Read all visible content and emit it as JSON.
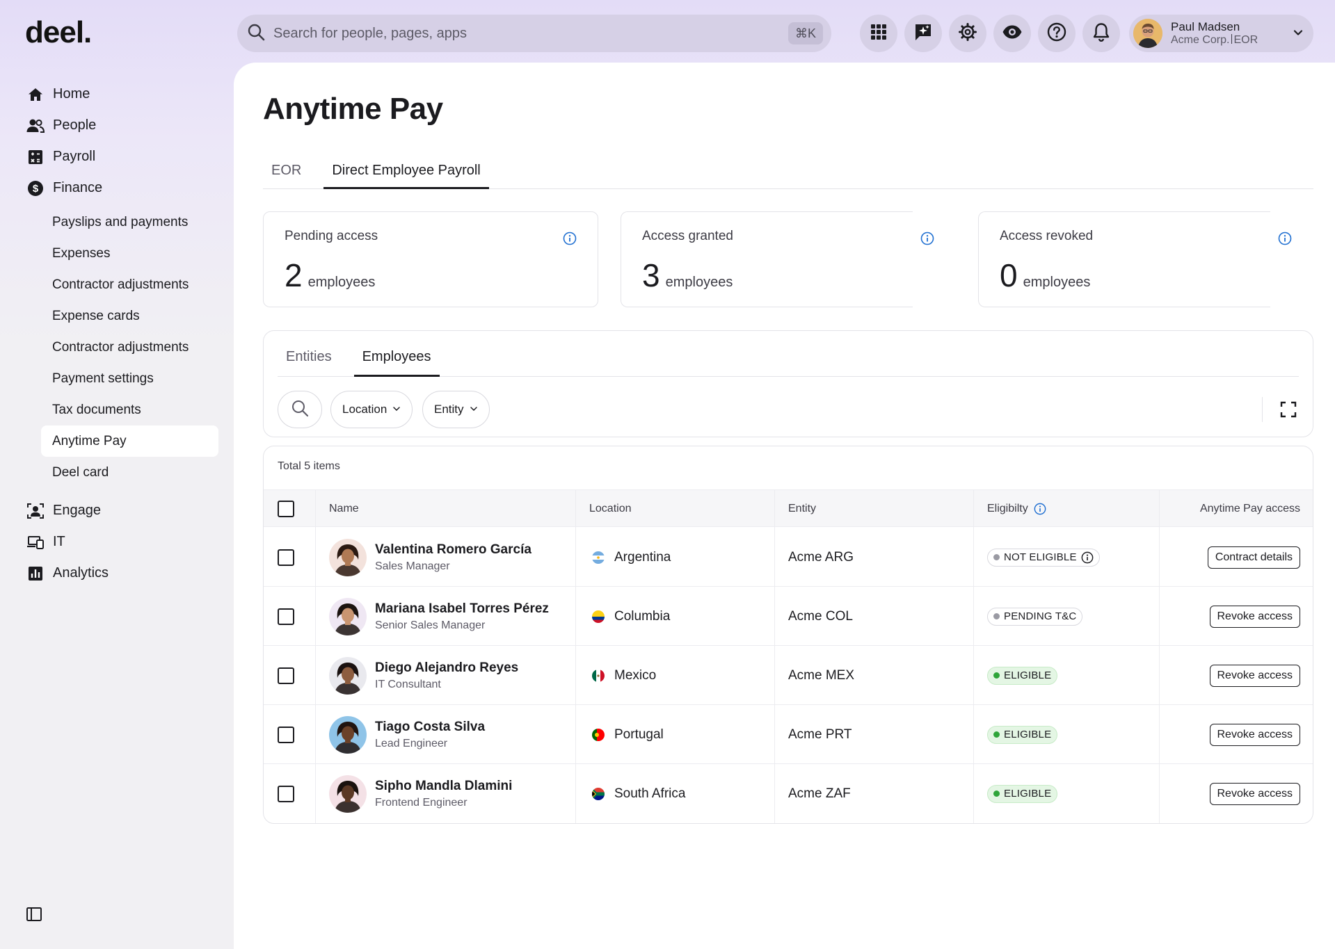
{
  "app": {
    "logo": "deel."
  },
  "sidebar": {
    "items": [
      {
        "label": "Home",
        "icon": "home-icon"
      },
      {
        "label": "People",
        "icon": "people-icon"
      },
      {
        "label": "Payroll",
        "icon": "payroll-icon"
      },
      {
        "label": "Finance",
        "icon": "dollar-icon"
      }
    ],
    "finance_sub": [
      "Payslips and payments",
      "Expenses",
      "Contractor adjustments",
      "Expense cards",
      "Contractor adjustments",
      "Payment settings",
      "Tax documents",
      "Anytime Pay",
      "Deel card"
    ],
    "bottom_items": [
      {
        "label": "Engage",
        "icon": "engage-icon"
      },
      {
        "label": "IT",
        "icon": "devices-icon"
      },
      {
        "label": "Analytics",
        "icon": "analytics-icon"
      }
    ]
  },
  "topbar": {
    "search_placeholder": "Search for people, pages, apps",
    "shortcut": "⌘K",
    "user_name": "Paul Madsen",
    "user_org": "Acme Corp.",
    "user_type": "EOR"
  },
  "page": {
    "title": "Anytime Pay",
    "tabs": [
      "EOR",
      "Direct Employee Payroll"
    ]
  },
  "stats": [
    {
      "label": "Pending access",
      "value": "2",
      "unit": "employees"
    },
    {
      "label": "Access granted",
      "value": "3",
      "unit": "employees"
    },
    {
      "label": "Access revoked",
      "value": "0",
      "unit": "employees"
    }
  ],
  "filters": {
    "sub_tabs": [
      "Entities",
      "Employees"
    ],
    "location_label": "Location",
    "entity_label": "Entity"
  },
  "table": {
    "total": "Total 5 items",
    "headers": {
      "name": "Name",
      "location": "Location",
      "entity": "Entity",
      "eligibility": "Eligibilty",
      "access": "Anytime Pay access"
    },
    "rows": [
      {
        "name": "Valentina Romero García",
        "role": "Sales Manager",
        "location": "Argentina",
        "entity": "Acme ARG",
        "status": "NOT ELIGIBLE",
        "status_type": "grey",
        "action": "Contract details",
        "skin": "#b07a55",
        "hair": "#2b1a12",
        "bg": "#f3e2dc"
      },
      {
        "name": "Mariana Isabel Torres Pérez",
        "role": "Senior Sales Manager",
        "location": "Columbia",
        "entity": "Acme COL",
        "status": "PENDING T&C",
        "status_type": "grey",
        "action": "Revoke access",
        "skin": "#c99571",
        "hair": "#1c1410",
        "bg": "#efe7f3"
      },
      {
        "name": "Diego Alejandro Reyes",
        "role": "IT Consultant",
        "location": "Mexico",
        "entity": "Acme MEX",
        "status": "ELIGIBLE",
        "status_type": "green",
        "action": "Revoke access",
        "skin": "#8d5d3f",
        "hair": "#1a1210",
        "bg": "#e9e9ee"
      },
      {
        "name": "Tiago Costa Silva",
        "role": "Lead Engineer",
        "location": "Portugal",
        "entity": "Acme PRT",
        "status": "ELIGIBLE",
        "status_type": "green",
        "action": "Revoke access",
        "skin": "#6b4128",
        "hair": "#201410",
        "bg": "#8fc4e8"
      },
      {
        "name": "Sipho Mandla Dlamini",
        "role": "Frontend Engineer",
        "location": "South Africa",
        "entity": "Acme ZAF",
        "status": "ELIGIBLE",
        "status_type": "green",
        "action": "Revoke access",
        "skin": "#5a3824",
        "hair": "#1a120e",
        "bg": "#f4e1e6"
      }
    ]
  },
  "colors": {
    "accent": "#1f6fd1",
    "sidebar_bg": "#f1f0f3",
    "header_bg": "#e3dcf7",
    "eligible": "#2fa53a"
  }
}
